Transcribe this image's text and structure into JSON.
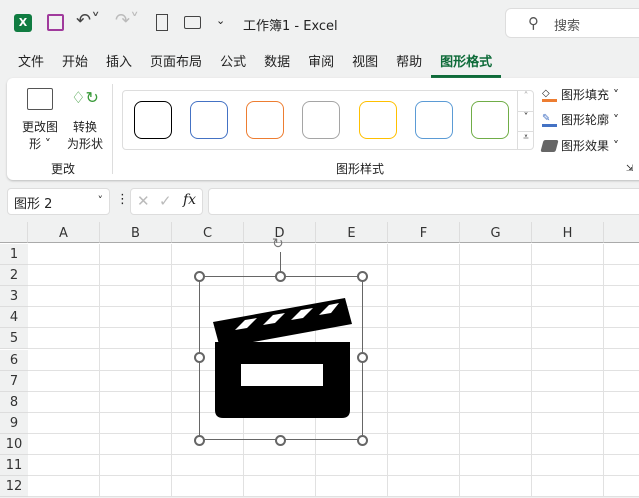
{
  "titlebar": {
    "title": "工作簿1  -  Excel",
    "search_placeholder": "搜索"
  },
  "tabs": [
    "文件",
    "开始",
    "插入",
    "页面布局",
    "公式",
    "数据",
    "审阅",
    "视图",
    "帮助",
    "图形格式"
  ],
  "ribbon": {
    "change_shape_l1": "更改图",
    "change_shape_l2": "形",
    "convert_l1": "转换",
    "convert_l2": "为形状",
    "group_change": "更改",
    "group_styles": "图形样式",
    "fill": "图形填充",
    "outline": "图形轮廓",
    "effects": "图形效果",
    "swatch_colors": [
      "#000000",
      "#4472c4",
      "#ed7d31",
      "#a5a5a5",
      "#ffc000",
      "#5b9bd5",
      "#70ad47"
    ]
  },
  "formula": {
    "name_box": "图形 2",
    "fx": "fx",
    "value": ""
  },
  "columns": [
    "A",
    "B",
    "C",
    "D",
    "E",
    "F",
    "G",
    "H"
  ],
  "rows": [
    "1",
    "2",
    "3",
    "4",
    "5",
    "6",
    "7",
    "8",
    "9",
    "10",
    "11",
    "12"
  ],
  "accent": "#0e6b39"
}
